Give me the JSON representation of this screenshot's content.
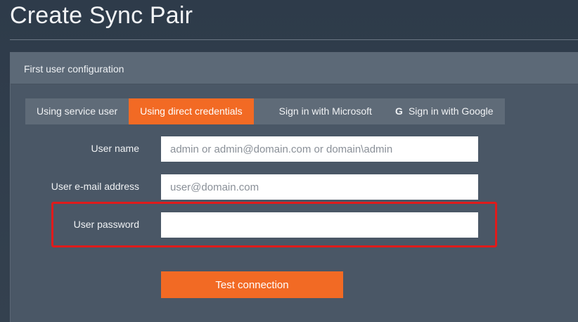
{
  "page": {
    "title": "Create Sync Pair"
  },
  "panel": {
    "header": "First user configuration"
  },
  "tabs": [
    {
      "label": "Using service user",
      "active": false,
      "icon": ""
    },
    {
      "label": "Using direct credentials",
      "active": true,
      "icon": ""
    },
    {
      "label": "Sign in with Microsoft",
      "active": false,
      "icon": "windows-icon"
    },
    {
      "label": "Sign in with Google",
      "active": false,
      "icon": "google-icon",
      "glyph": "G"
    }
  ],
  "form": {
    "user_name": {
      "label": "User name",
      "value": "",
      "placeholder": "admin or admin@domain.com or domain\\admin"
    },
    "user_email": {
      "label": "User e-mail address",
      "value": "",
      "placeholder": "user@domain.com"
    },
    "user_password": {
      "label": "User password",
      "value": "",
      "placeholder": ""
    }
  },
  "actions": {
    "test_connection_label": "Test connection"
  },
  "colors": {
    "accent": "#f26a24",
    "highlight": "#e01b1b",
    "panel": "#4a5766",
    "panel_header": "#5c6977",
    "background": "#2f3c4b"
  }
}
